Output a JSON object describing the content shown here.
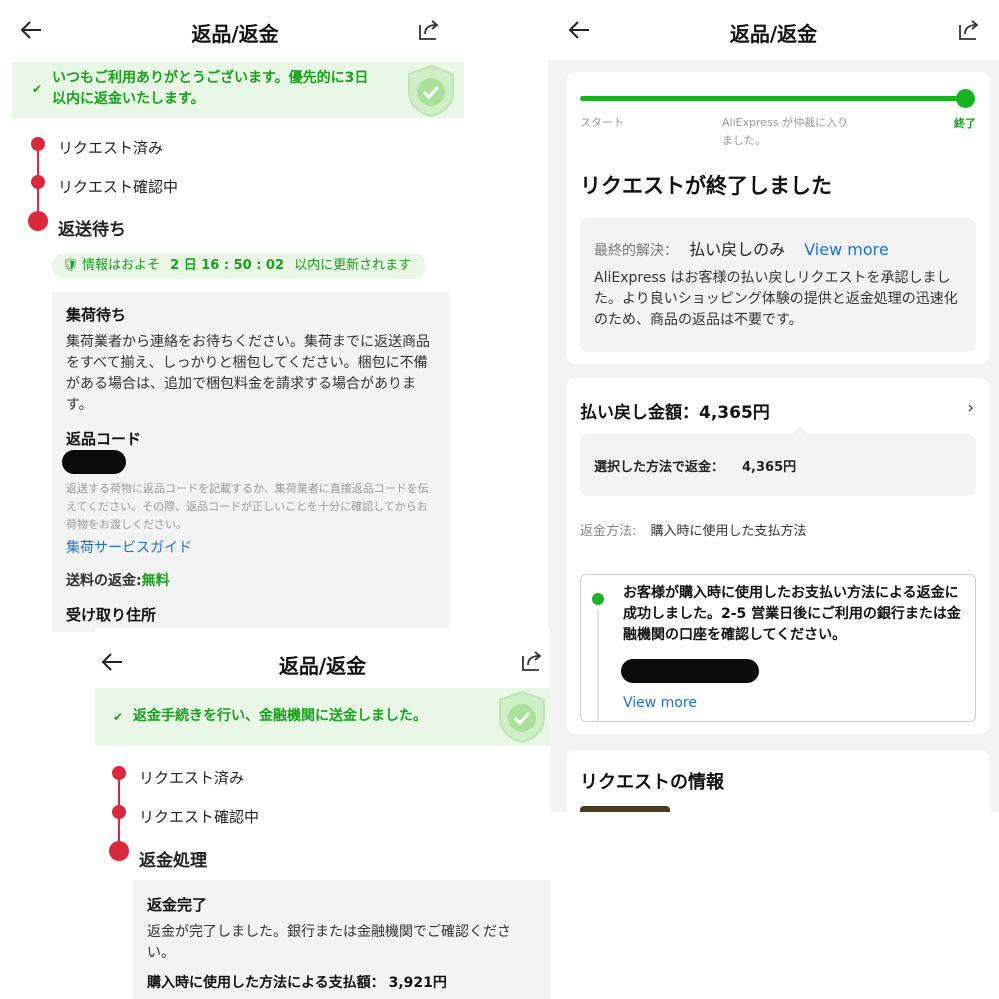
{
  "colors": {
    "accent_red": "#d9293d",
    "accent_green": "#17a31a",
    "link": "#1a73d9"
  },
  "panel1": {
    "header": {
      "title": "返品/返金",
      "back_icon": "arrow-left-icon",
      "share_icon": "share-icon"
    },
    "banner": {
      "text": "いつもご利用ありがとうございます。優先的に3日以内に返金いたします。"
    },
    "steps": [
      {
        "label": "リクエスト済み"
      },
      {
        "label": "リクエスト確認中"
      },
      {
        "label": "返送待ち"
      }
    ],
    "timer": {
      "prefix": "情報はおよそ",
      "value": "2 日 16 : 50 : 02",
      "suffix": "以内に更新されます"
    },
    "box": {
      "title": "集荷待ち",
      "body": "集荷業者から連絡をお待ちください。集荷までに返送商品をすべて揃え、しっかりと梱包してください。梱包に不備がある場合は、追加で梱包料金を請求する場合があります。",
      "code_title": "返品コード",
      "note": "返送する荷物に返品コードを記載するか、集荷業者に直接返品コードを伝えてください。その際、返品コードが正しいことを十分に確認してからお荷物をお渡しください。",
      "guide_link": "集荷サービスガイド",
      "shipping_label": "送料の返金:",
      "shipping_value": "無料",
      "address_label": "受け取り住所"
    }
  },
  "panel2": {
    "header": {
      "title": "返品/返金"
    },
    "progress": {
      "value": 1.0,
      "start": "スタート",
      "middle": "AliExpress が仲裁に入りました。",
      "end": "終了"
    },
    "heading": "リクエストが終了しました",
    "resolution": {
      "label": "最終的解決：",
      "value": "払い戻しのみ",
      "link": "View more",
      "desc": "AliExpress はお客様の払い戻しリクエストを承認しました。より良いショッピング体験の提供と返金処理の迅速化のため、商品の返品は不要です。"
    },
    "refund": {
      "amount_label": "払い戻し金額：",
      "amount": "4,365円",
      "method_label": "選択した方法で返金：",
      "method_amount": "4,365円",
      "payment_label": "返金方法:",
      "payment_value": "購入時に使用した支払方法"
    },
    "notice": {
      "text": "お客様が購入時に使用したお支払い方法による返金に成功しました。2-5 営業日後にご利用の銀行または金融機関の口座を確認してください。",
      "link": "View more"
    },
    "info_heading": "リクエストの情報"
  },
  "panel3": {
    "header": {
      "title": "返品/返金"
    },
    "banner": {
      "text": "返金手続きを行い、金融機関に送金しました。"
    },
    "steps": [
      {
        "label": "リクエスト済み"
      },
      {
        "label": "リクエスト確認中"
      },
      {
        "label": "返金処理"
      }
    ],
    "box": {
      "title": "返金完了",
      "body": "返金が完了しました。銀行または金融機関でご確認ください。",
      "amount_label": "購入時に使用した方法による支払額：",
      "amount": "3,921円"
    }
  }
}
